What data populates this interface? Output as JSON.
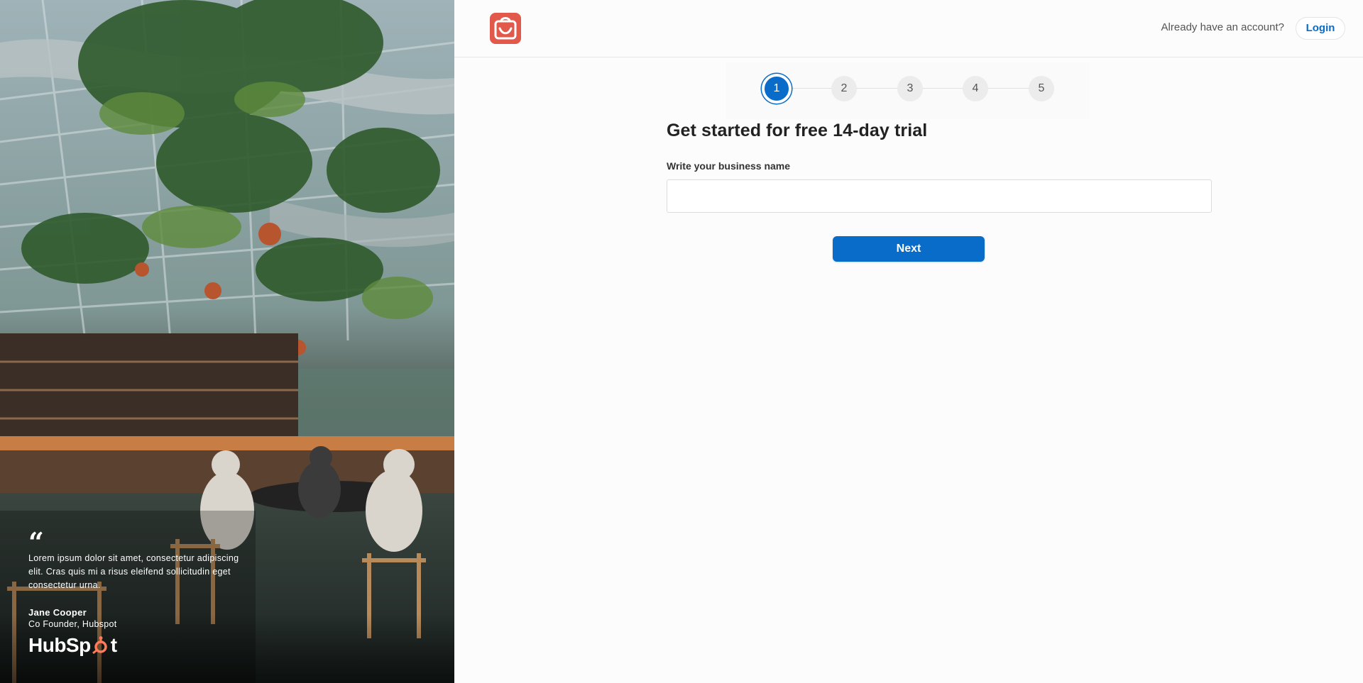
{
  "header": {
    "logo_icon": "smiley-bag-icon",
    "have_account_text": "Already have an account?",
    "login_label": "Login"
  },
  "stepper": {
    "steps": [
      "1",
      "2",
      "3",
      "4",
      "5"
    ],
    "active_step": 1
  },
  "form": {
    "title": "Get started for free 14-day trial",
    "business_name_label": "Write your business name",
    "business_name_value": "",
    "next_label": "Next"
  },
  "testimonial": {
    "quote_mark": "“",
    "quote_text": "Lorem ipsum dolor sit amet, consectetur adipiscing elit. Cras quis mi a risus eleifend sollicitudin eget consectetur urna.",
    "author_name": "Jane Cooper",
    "author_role": "Co Founder, Hubspot",
    "brand_left": "HubSp",
    "brand_right": "t"
  },
  "colors": {
    "accent": "#0a6cc9",
    "logo_bg": "#e2584a",
    "brand_orange": "#ff7a59"
  }
}
